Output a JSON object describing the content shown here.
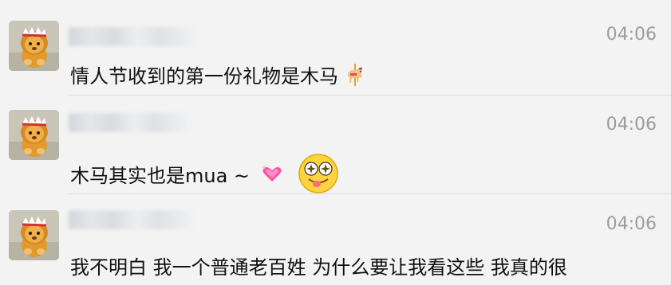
{
  "messages": [
    {
      "time": "04:06",
      "text": "情人节收到的第一份礼物是木马",
      "emojis": [
        "carousel-horse-emoji"
      ]
    },
    {
      "time": "04:06",
      "text": "木马其实也是mua ~",
      "emojis": [
        "sparkling-heart-emoji",
        "starry-eyed-tongue-face-emoji"
      ]
    },
    {
      "time": "04:06",
      "text": "我不明白 我一个普通老百姓 为什么要让我看这些 我真的很",
      "text_cut": "",
      "emojis": []
    }
  ],
  "colors": {
    "background": "#f3f3f3",
    "time": "#9c9c9c",
    "text": "#111111",
    "divider": "#dcdcdc"
  }
}
